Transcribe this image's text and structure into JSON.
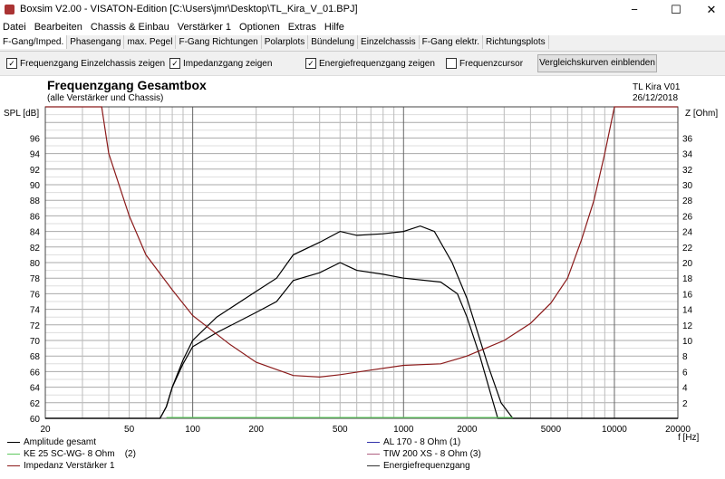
{
  "window": {
    "title": "Boxsim V2.00 - VISATON-Edition [C:\\Users\\jmr\\Desktop\\TL_Kira_V_01.BPJ]",
    "minimize": "−",
    "maximize": "☐",
    "close": "✕"
  },
  "menu": [
    "Datei",
    "Bearbeiten",
    "Chassis & Einbau",
    "Verstärker 1",
    "Optionen",
    "Extras",
    "Hilfe"
  ],
  "tabs": [
    "F-Gang/Imped.",
    "Phasengang",
    "max. Pegel",
    "F-Gang Richtungen",
    "Polarplots",
    "Bündelung",
    "Einzelchassis",
    "F-Gang elektr.",
    "Richtungsplots"
  ],
  "options": {
    "cb1": "Frequenzgang Einzelchassis zeigen",
    "cb2": "Impedanzgang zeigen",
    "cb3": "Energiefrequenzgang zeigen",
    "cb4": "Frequenzcursor",
    "check": "✓",
    "compare_button": "Vergleichskurven einblenden"
  },
  "chart_data": {
    "type": "line",
    "title": "Frequenzgang Gesamtbox",
    "subtitle": "(alle Verstärker und Chassis)",
    "project": "TL Kira V01",
    "date": "26/12/2018",
    "ylabel": "SPL [dB]",
    "y2label": "Z [Ohm]",
    "xlabel": "f [Hz]",
    "xlim": [
      20,
      20000
    ],
    "ylim": [
      60,
      100
    ],
    "y2lim": [
      0,
      40
    ],
    "xticks": [
      20,
      50,
      100,
      200,
      500,
      1000,
      2000,
      5000,
      10000,
      20000
    ],
    "yticks": [
      60,
      62,
      64,
      66,
      68,
      70,
      72,
      74,
      76,
      78,
      80,
      82,
      84,
      86,
      88,
      90,
      92,
      94,
      96
    ],
    "y2ticks": [
      2,
      4,
      6,
      8,
      10,
      12,
      14,
      16,
      18,
      20,
      22,
      24,
      26,
      28,
      30,
      32,
      34,
      36
    ],
    "series": [
      {
        "name": "Amplitude gesamt",
        "color": "#000000",
        "axis": "y",
        "x": [
          20,
          70,
          75,
          80,
          90,
          100,
          130,
          200,
          250,
          300,
          400,
          500,
          600,
          800,
          1000,
          1200,
          1400,
          1700,
          2000,
          2500,
          2900,
          3300,
          20000
        ],
        "y": [
          60,
          60,
          61.5,
          64,
          67.5,
          70,
          73,
          76.3,
          78,
          81,
          82.6,
          84,
          83.5,
          83.7,
          84,
          84.7,
          84,
          80,
          75.4,
          67,
          62,
          60,
          60
        ]
      },
      {
        "name": "Energiefrequenzgang",
        "color": "#000000",
        "axis": "y",
        "x": [
          20,
          70,
          75,
          80,
          90,
          100,
          130,
          200,
          250,
          300,
          400,
          500,
          600,
          800,
          1000,
          1500,
          1800,
          2000,
          2300,
          2600,
          2800,
          20000
        ],
        "y": [
          60,
          60,
          61.5,
          64,
          67,
          69.2,
          71,
          73.6,
          75,
          77.7,
          78.7,
          80,
          79,
          78.5,
          78,
          77.5,
          76,
          73,
          68,
          63,
          60,
          60
        ]
      },
      {
        "name": "KE 25 SC-WG- 8 Ohm    (2)",
        "color": "#5ec85e",
        "axis": "y",
        "x": [
          75,
          3300
        ],
        "y": [
          60.1,
          60.1
        ]
      },
      {
        "name": "Impedanz Verstärker 1",
        "color": "#8b1a1a",
        "axis": "y2",
        "x": [
          20,
          37,
          40,
          50,
          60,
          80,
          100,
          150,
          200,
          300,
          400,
          500,
          700,
          1000,
          1500,
          2000,
          3000,
          4000,
          5000,
          6000,
          7000,
          8000,
          9000,
          10000,
          20000
        ],
        "y": [
          40,
          40,
          34,
          26,
          21,
          16.5,
          13.2,
          9.5,
          7.2,
          5.5,
          5.3,
          5.6,
          6.2,
          6.8,
          7,
          8,
          10,
          12.2,
          14.8,
          18,
          23,
          28,
          34,
          40,
          40
        ]
      }
    ]
  },
  "legend": {
    "l1": "Amplitude gesamt",
    "l2": "KE 25 SC-WG- 8 Ohm    (2)",
    "l3": "Impedanz Verstärker 1",
    "r1": "AL 170 - 8 Ohm (1)",
    "r2": "TIW 200 XS - 8 Ohm (3)",
    "r3": "Energiefrequenzgang"
  }
}
